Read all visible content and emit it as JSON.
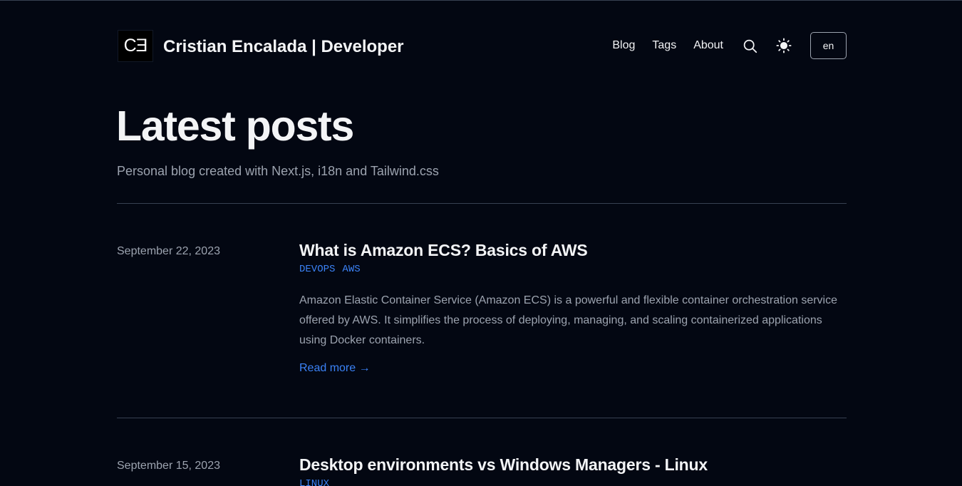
{
  "header": {
    "logo_text": "CƎ",
    "site_title": "Cristian Encalada | Developer",
    "nav": [
      "Blog",
      "Tags",
      "About"
    ],
    "search_icon": "search-icon",
    "theme_icon": "sun-icon",
    "language": "en"
  },
  "main": {
    "title": "Latest posts",
    "subtitle": "Personal blog created with Next.js, i18n and Tailwind.css"
  },
  "posts": [
    {
      "date": "September 22, 2023",
      "title": "What is Amazon ECS? Basics of AWS",
      "tags": [
        "DEVOPS",
        "AWS"
      ],
      "summary": "Amazon Elastic Container Service (Amazon ECS) is a powerful and flexible container orchestration service offered by AWS. It simplifies the process of deploying, managing, and scaling containerized applications using Docker containers.",
      "read_more": "Read more →"
    },
    {
      "date": "September 15, 2023",
      "title": "Desktop environments vs Windows Managers - Linux",
      "tags": [
        "LINUX"
      ]
    }
  ],
  "colors": {
    "background": "#030712",
    "text": "#f3f4f6",
    "muted": "#9ca3af",
    "accent": "#3b82f6",
    "divider": "#374151"
  }
}
